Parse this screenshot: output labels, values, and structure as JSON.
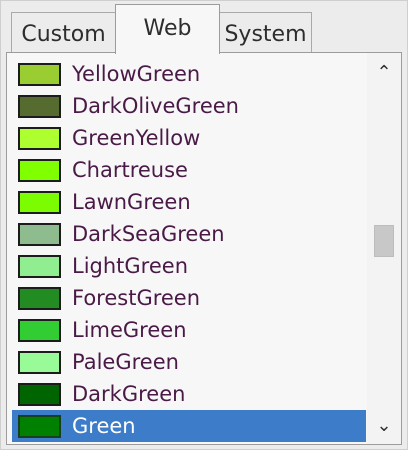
{
  "tabs": [
    {
      "label": "Custom",
      "active": false
    },
    {
      "label": "Web",
      "active": true
    },
    {
      "label": "System",
      "active": false
    }
  ],
  "colors": [
    {
      "name": "YellowGreen",
      "hex": "#9acd32"
    },
    {
      "name": "DarkOliveGreen",
      "hex": "#556b2f"
    },
    {
      "name": "GreenYellow",
      "hex": "#adff2f"
    },
    {
      "name": "Chartreuse",
      "hex": "#7fff00"
    },
    {
      "name": "LawnGreen",
      "hex": "#7cfc00"
    },
    {
      "name": "DarkSeaGreen",
      "hex": "#8fbc8f"
    },
    {
      "name": "LightGreen",
      "hex": "#90ee90"
    },
    {
      "name": "ForestGreen",
      "hex": "#228b22"
    },
    {
      "name": "LimeGreen",
      "hex": "#32cd32"
    },
    {
      "name": "PaleGreen",
      "hex": "#98fb98"
    },
    {
      "name": "DarkGreen",
      "hex": "#006400"
    },
    {
      "name": "Green",
      "hex": "#008000"
    }
  ],
  "selected_index": 11,
  "scrollbar": {
    "up_icon": "chevron-up-icon",
    "down_icon": "chevron-down-icon"
  }
}
